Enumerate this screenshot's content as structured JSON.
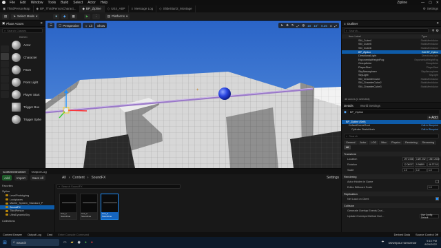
{
  "window": {
    "title": "Zipline"
  },
  "menu": [
    "File",
    "Edit",
    "Window",
    "Tools",
    "Build",
    "Select",
    "Actor",
    "Help"
  ],
  "tabs": [
    {
      "label": "ThirdPersonMap",
      "active": false
    },
    {
      "label": "BP_ThirdPersonCharact...",
      "active": false
    },
    {
      "label": "BP_Zipline",
      "active": true
    },
    {
      "label": "UE4_ABP",
      "active": false
    },
    {
      "label": "Message Log",
      "active": false
    },
    {
      "label": "SlideStart2_Montage",
      "active": false
    }
  ],
  "toolbar": {
    "select_mode": "Select Mode",
    "platforms": "Platforms",
    "settings": "Settings"
  },
  "viewport": {
    "perspective": "Perspective",
    "lit": "Lit",
    "show": "Show",
    "grid_snap": "10",
    "rot_snap": "10°",
    "scale_snap": "0.25",
    "cam_speed": "4"
  },
  "place_actors": {
    "title": "Place Actors",
    "search_placeholder": "Search Classes",
    "section": "BASIC",
    "items": [
      "Actor",
      "Character",
      "Pawn",
      "Point Light",
      "Player Start",
      "Trigger Box",
      "Trigger Sphe"
    ]
  },
  "outliner": {
    "title": "Outliner",
    "search_placeholder": "Search...",
    "col_label": "Item Label",
    "col_type": "Type",
    "items": [
      {
        "label": "SM_Cube4",
        "type": "StaticMeshActor"
      },
      {
        "label": "SM_Cube5",
        "type": "StaticMeshActor"
      },
      {
        "label": "SM_Cube6",
        "type": "StaticMeshActor"
      },
      {
        "label": "BP_Zipline",
        "type": "Edit BP_Zipline",
        "selected": true
      },
      {
        "label": "DirectionalLight",
        "type": "DirectionalLight"
      },
      {
        "label": "ExponentialHeightFog",
        "type": "ExponentialHeightFog"
      },
      {
        "label": "GroupActor",
        "type": "GroupActor"
      },
      {
        "label": "PlayerStart",
        "type": "PlayerStart"
      },
      {
        "label": "SkyAtmosphere",
        "type": "SkyAtmosphere"
      },
      {
        "label": "SkyLight",
        "type": "SkyLight"
      },
      {
        "label": "SM_ChamferCube",
        "type": "StaticMeshActor"
      },
      {
        "label": "SM_ChamferCube2",
        "type": "StaticMeshActor"
      },
      {
        "label": "SM_ChamferCube3",
        "type": "StaticMeshActor"
      }
    ],
    "footer": "46 actors (1 selected)"
  },
  "details": {
    "tab_details": "Details",
    "tab_world": "World Settings",
    "actor_name": "BP_Zipline",
    "component_root": "BP_Zipline (Self)",
    "components": [
      {
        "label": "DefaultSceneRoot",
        "link": "Edit in Blueprint"
      },
      {
        "label": "Cylinder StaticMesh",
        "link": "Edit in Blueprint"
      }
    ],
    "search_placeholder": "Search",
    "filter_tabs": [
      "General",
      "Actor",
      "LOD",
      "Misc",
      "Physics",
      "Rendering",
      "Streaming",
      "All"
    ],
    "transform": {
      "title": "Transform",
      "location": {
        "label": "Location",
        "x": "1971.068",
        "y": "1487.252",
        "z": "1567.2630"
      },
      "rotation": {
        "label": "Rotation",
        "x": "12.06037",
        "y": "5.96899",
        "z": "46.37310"
      },
      "scale": {
        "label": "Scale",
        "x": "1.0",
        "y": "1.0",
        "z": "1.0"
      }
    },
    "rendering": {
      "title": "Rendering",
      "hidden": "Actor Hidden in Game",
      "billboard": "Editor Billboard Scale",
      "billboard_val": "1.0"
    },
    "replication": {
      "title": "Replication",
      "net_load": "Net Load on Client"
    },
    "collision": {
      "title": "Collision",
      "overlap": "Generate Overlap Events Duri...",
      "update_method": "Update Overlaps Method Duri...",
      "update_val": "Use Config Default"
    }
  },
  "content_browser": {
    "tab1": "Content Browser",
    "tab2": "Output Log",
    "add": "Add",
    "import": "Import",
    "save_all": "Save All",
    "breadcrumb": [
      "All",
      "Content",
      "SoundFX"
    ],
    "search_placeholder": "Search SoundFX",
    "settings": "Settings",
    "favorites": "Favorites",
    "root": "Zipline",
    "folders": [
      "LevelPrototyping",
      "Lockplaces",
      "Mantle_System_Standard_P",
      "SoundFX",
      "ThirdPerson",
      "UltraDynamicSky"
    ],
    "collections": "Collections",
    "assets": [
      {
        "name": "Cue_1",
        "type": "SoundCue"
      },
      {
        "name": "Cue_2",
        "type": "SoundCue"
      },
      {
        "name": "Cue_3",
        "type": "SoundCue",
        "selected": true
      }
    ],
    "footer": "3 items (1 selected)"
  },
  "bottombar": {
    "content_drawer": "Content Drawer",
    "output_log": "Output Log",
    "cmd": "Cmd",
    "console_placeholder": "Enter Console Command",
    "derived": "Derived Data",
    "source_control": "Source Control Off"
  },
  "taskbar": {
    "search_placeholder": "Search",
    "weather": "Downpour tomorrow",
    "time": "9:10 PM",
    "date": "8/26/2022"
  }
}
